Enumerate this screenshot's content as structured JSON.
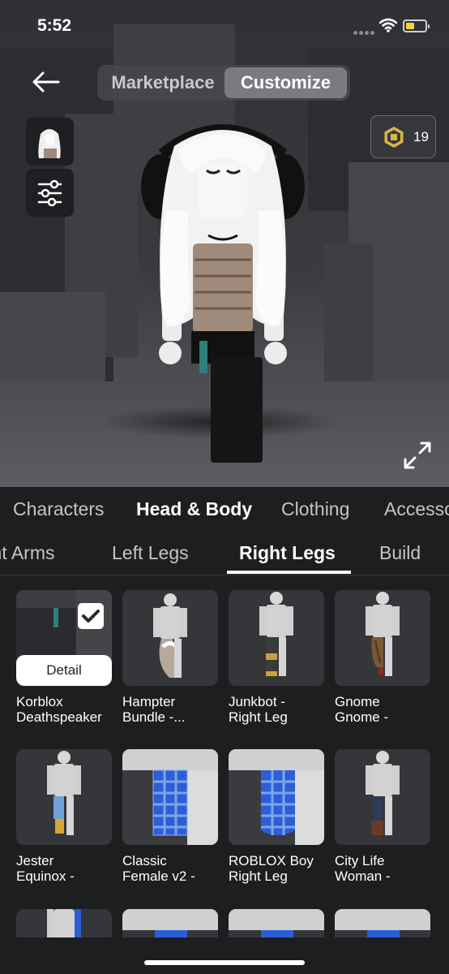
{
  "status_bar": {
    "time": "5:52"
  },
  "header": {
    "segments": [
      "Marketplace",
      "Customize"
    ],
    "active_segment": "Customize",
    "robux_balance": "19"
  },
  "category_tabs": [
    "Characters",
    "Head & Body",
    "Clothing",
    "Accessories"
  ],
  "active_category": "Head & Body",
  "sub_tabs": [
    "Right Arms",
    "Left Legs",
    "Right Legs",
    "Build"
  ],
  "active_sub_tab": "Right Legs",
  "items": [
    {
      "line1": "Korblox",
      "line2": "Deathspeaker",
      "selected": true,
      "detail_label": "Detail"
    },
    {
      "line1": "Hampter",
      "line2": "Bundle -..."
    },
    {
      "line1": "Junkbot -",
      "line2": "Right Leg"
    },
    {
      "line1": "Gnome",
      "line2": "Gnome -"
    },
    {
      "line1": "Jester",
      "line2": "Equinox -"
    },
    {
      "line1": "Classic",
      "line2": "Female v2 -"
    },
    {
      "line1": "ROBLOX Boy",
      "line2": "Right Leg"
    },
    {
      "line1": "City Life",
      "line2": "Woman -"
    }
  ],
  "icons": {
    "back": "arrow-left-icon",
    "avatar_thumb": "avatar-thumbnail",
    "settings": "sliders-icon",
    "robux": "robux-icon",
    "expand": "expand-arrows-icon",
    "selected": "check-icon"
  },
  "colors": {
    "background": "#1d1e20",
    "robux_gold": "#d8b54a",
    "tile": "#35363a"
  }
}
